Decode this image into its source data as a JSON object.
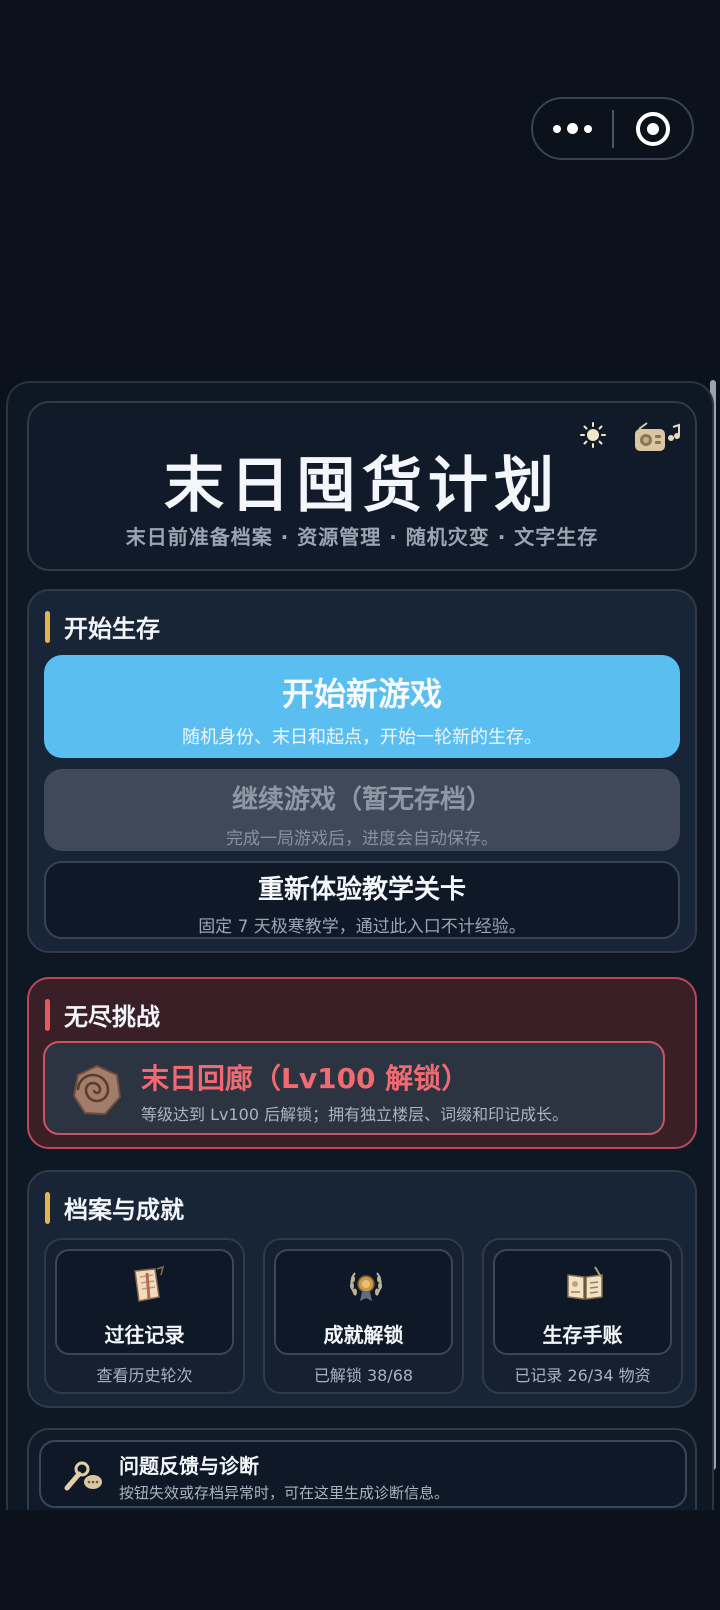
{
  "app": {
    "title": "末日囤货计划",
    "subtitle": "末日前准备档案 · 资源管理 · 随机灾变 · 文字生存",
    "icons": {
      "theme": "sun-icon",
      "music": "radio-music-icon"
    }
  },
  "capsule": {
    "more_icon": "more-dots-icon",
    "close_icon": "target-icon"
  },
  "start_section": {
    "heading": "开始生存",
    "new_game": {
      "label": "开始新游戏",
      "desc": "随机身份、末日和起点，开始一轮新的生存。"
    },
    "continue_game": {
      "label": "继续游戏（暂无存档）",
      "desc": "完成一局游戏后，进度会自动保存。"
    },
    "tutorial": {
      "label": "重新体验教学关卡",
      "desc": "固定 7 天极寒教学，通过此入口不计经验。"
    }
  },
  "endless_section": {
    "heading": "无尽挑战",
    "corridor": {
      "label": "末日回廊（Lv100 解锁）",
      "desc": "等级达到 Lv100 后解锁；拥有独立楼层、词缀和印记成长。"
    }
  },
  "archive_section": {
    "heading": "档案与成就",
    "tiles": [
      {
        "label": "过往记录",
        "stat": "查看历史轮次",
        "icon": "scroll-icon"
      },
      {
        "label": "成就解锁",
        "stat": "已解锁 38/68",
        "icon": "laurel-medal-icon"
      },
      {
        "label": "生存手账",
        "stat": "已记录 26/34 物资",
        "icon": "open-book-icon"
      }
    ]
  },
  "feedback": {
    "label": "问题反馈与诊断",
    "desc": "按钮失效或存档异常时，可在这里生成诊断信息。",
    "icon": "wrench-chat-icon"
  },
  "colors": {
    "accent_yellow": "#e6b54a",
    "primary_blue": "#5bbef0",
    "danger_red": "#e35a63"
  }
}
